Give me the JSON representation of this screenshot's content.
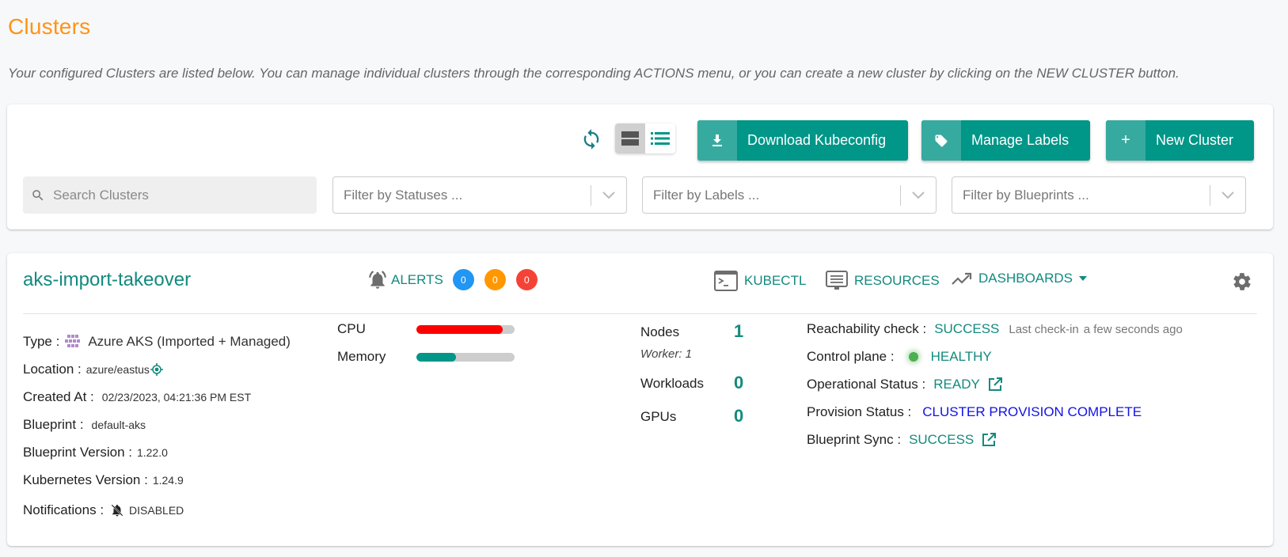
{
  "page": {
    "title": "Clusters",
    "description": "Your configured Clusters are listed below. You can manage individual clusters through the corresponding ACTIONS menu, or you can create a new cluster by clicking on the NEW CLUSTER button."
  },
  "toolbar": {
    "refresh_icon": "refresh-icon",
    "view_modes": [
      {
        "name": "card-view",
        "icon": "card-view-icon",
        "active": true
      },
      {
        "name": "list-view",
        "icon": "list-view-icon",
        "active": false
      }
    ],
    "buttons": {
      "download_kubeconfig": {
        "label": "Download Kubeconfig",
        "icon": "download-icon"
      },
      "manage_labels": {
        "label": "Manage Labels",
        "icon": "tag-icon"
      },
      "new_cluster": {
        "label": "New Cluster",
        "icon": "plus-icon",
        "icon_glyph": "+"
      }
    },
    "search": {
      "placeholder": "Search Clusters",
      "value": ""
    },
    "filters": {
      "statuses": {
        "placeholder": "Filter by Statuses ..."
      },
      "labels": {
        "placeholder": "Filter by Labels ..."
      },
      "blueprints": {
        "placeholder": "Filter by Blueprints ..."
      }
    }
  },
  "cluster": {
    "name": "aks-import-takeover",
    "alerts": {
      "label": "ALERTS",
      "counts": {
        "info": "0",
        "warning": "0",
        "critical": "0"
      }
    },
    "actions": {
      "kubectl": "KUBECTL",
      "resources": "RESOURCES",
      "dashboards": "DASHBOARDS"
    },
    "details": {
      "type": {
        "label": "Type :",
        "value": "Azure AKS (Imported + Managed)"
      },
      "location": {
        "label": "Location :",
        "value": "azure/eastus"
      },
      "created_at": {
        "label": "Created At :",
        "value": "02/23/2023, 04:21:36 PM EST"
      },
      "blueprint": {
        "label": "Blueprint :",
        "value": "default-aks"
      },
      "blueprint_version": {
        "label": "Blueprint Version :",
        "value": "1.22.0"
      },
      "kubernetes_version": {
        "label": "Kubernetes Version :",
        "value": "1.24.9"
      },
      "notifications": {
        "label": "Notifications :",
        "value": "DISABLED"
      }
    },
    "usage": {
      "cpu": {
        "label": "CPU",
        "fraction": 0.88,
        "color": "#ff0000"
      },
      "memory": {
        "label": "Memory",
        "fraction": 0.4,
        "color": "#009688"
      }
    },
    "stats": {
      "nodes": {
        "label": "Nodes",
        "value": "1",
        "sub": "Worker: 1"
      },
      "workloads": {
        "label": "Workloads",
        "value": "0"
      },
      "gpus": {
        "label": "GPUs",
        "value": "0"
      }
    },
    "status": {
      "reachability": {
        "label": "Reachability check :",
        "value": "SUCCESS",
        "sub_label": "Last check-in",
        "sub_value": "a few seconds ago"
      },
      "control_plane": {
        "label": "Control plane :",
        "value": "HEALTHY",
        "indicator_color": "#4caf50"
      },
      "operational": {
        "label": "Operational Status :",
        "value": "READY"
      },
      "provision": {
        "label": "Provision Status :",
        "value": "CLUSTER PROVISION COMPLETE"
      },
      "blueprint_sync": {
        "label": "Blueprint Sync :",
        "value": "SUCCESS"
      }
    }
  },
  "colors": {
    "accent": "#009688",
    "title": "#ff9416",
    "link_teal": "#138a7e",
    "provision_blue": "#1212e8"
  }
}
